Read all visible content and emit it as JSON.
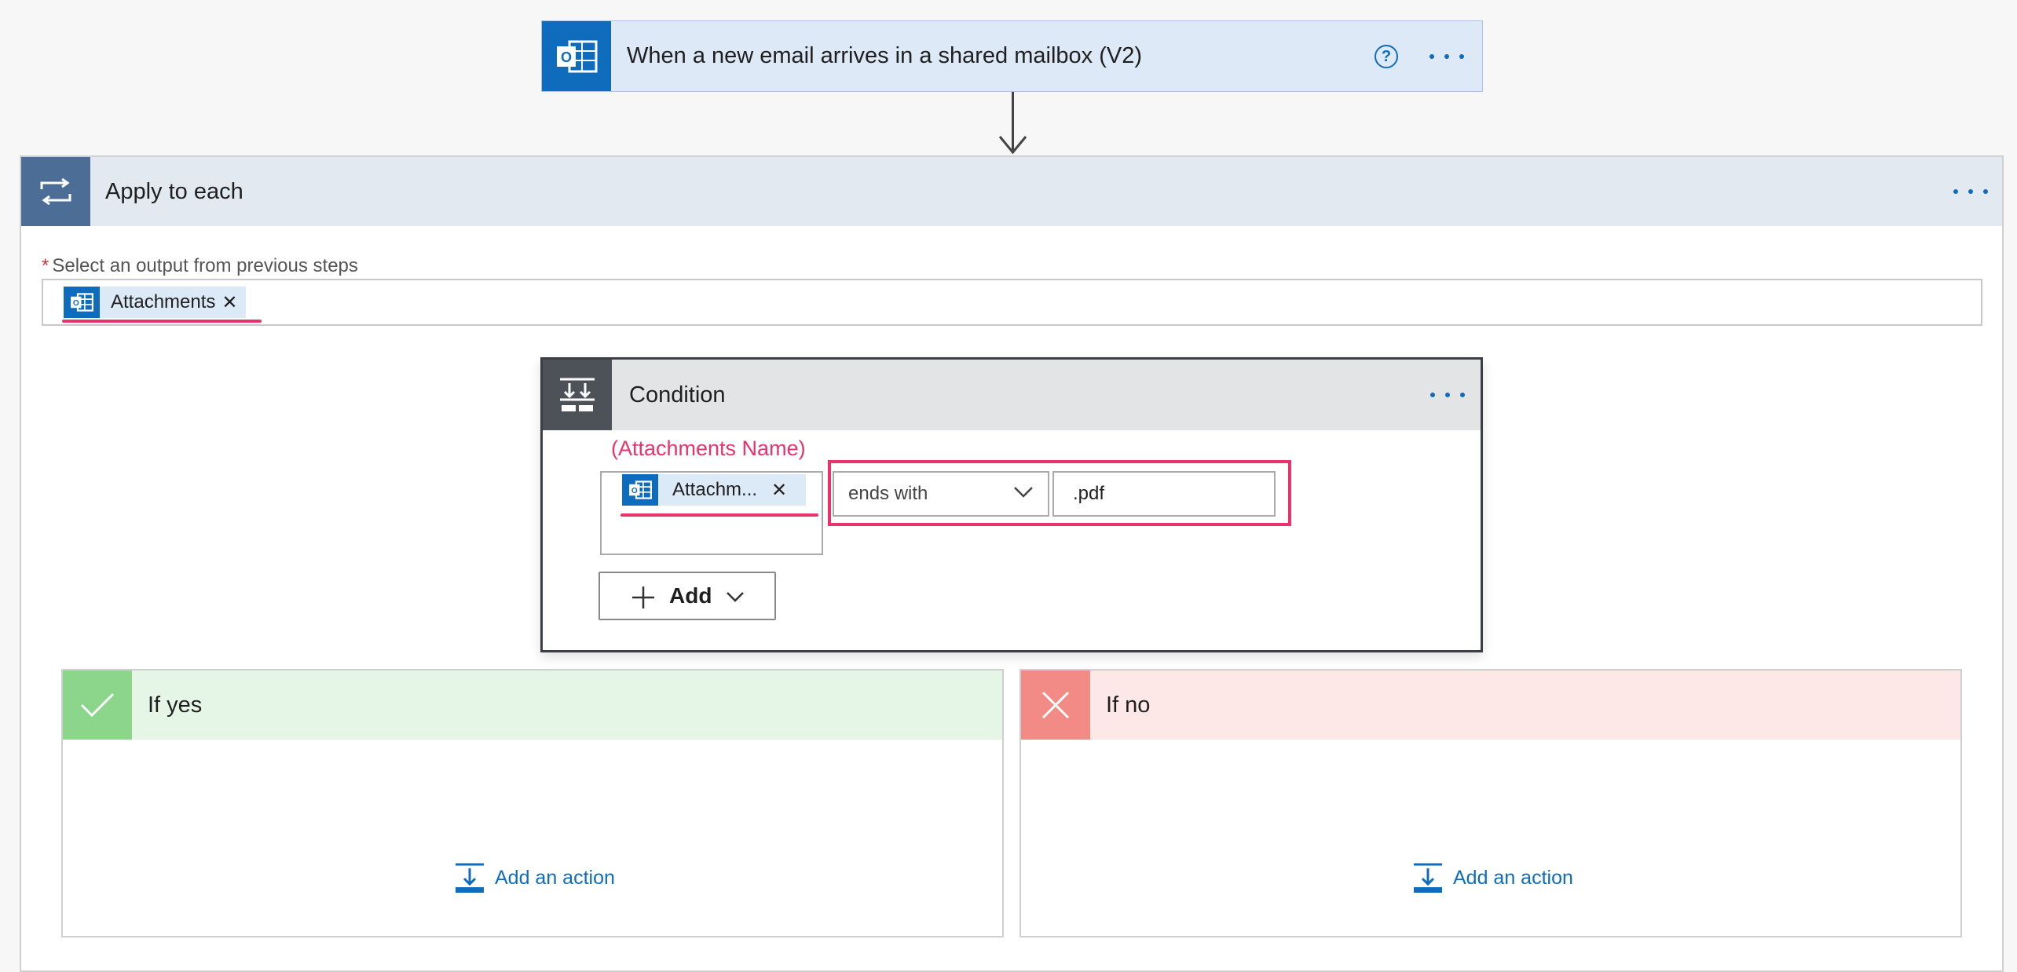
{
  "trigger": {
    "title": "When a new email arrives in a shared mailbox (V2)",
    "icon": "outlook-icon",
    "help_icon": "help-circle-icon",
    "more_icon": "more-dots-icon"
  },
  "apply_to_each": {
    "title": "Apply to each",
    "icon": "loop-icon",
    "field_label": "Select an output from previous steps",
    "required_marker": "*",
    "token_label": "Attachments",
    "token_close": "✕"
  },
  "condition": {
    "title": "Condition",
    "icon": "condition-icon",
    "annotation": "(Attachments Name)",
    "left_token_label": "Attachm...",
    "left_token_close": "✕",
    "operator": "ends with",
    "value": ".pdf",
    "add_label": "Add"
  },
  "branches": {
    "yes": {
      "title": "If yes",
      "add_action": "Add an action"
    },
    "no": {
      "title": "If no",
      "add_action": "Add an action"
    }
  },
  "colors": {
    "accent": "#0f6cbd",
    "highlight": "#e8336b",
    "yes": "#8bd68b",
    "no": "#f28b86"
  }
}
